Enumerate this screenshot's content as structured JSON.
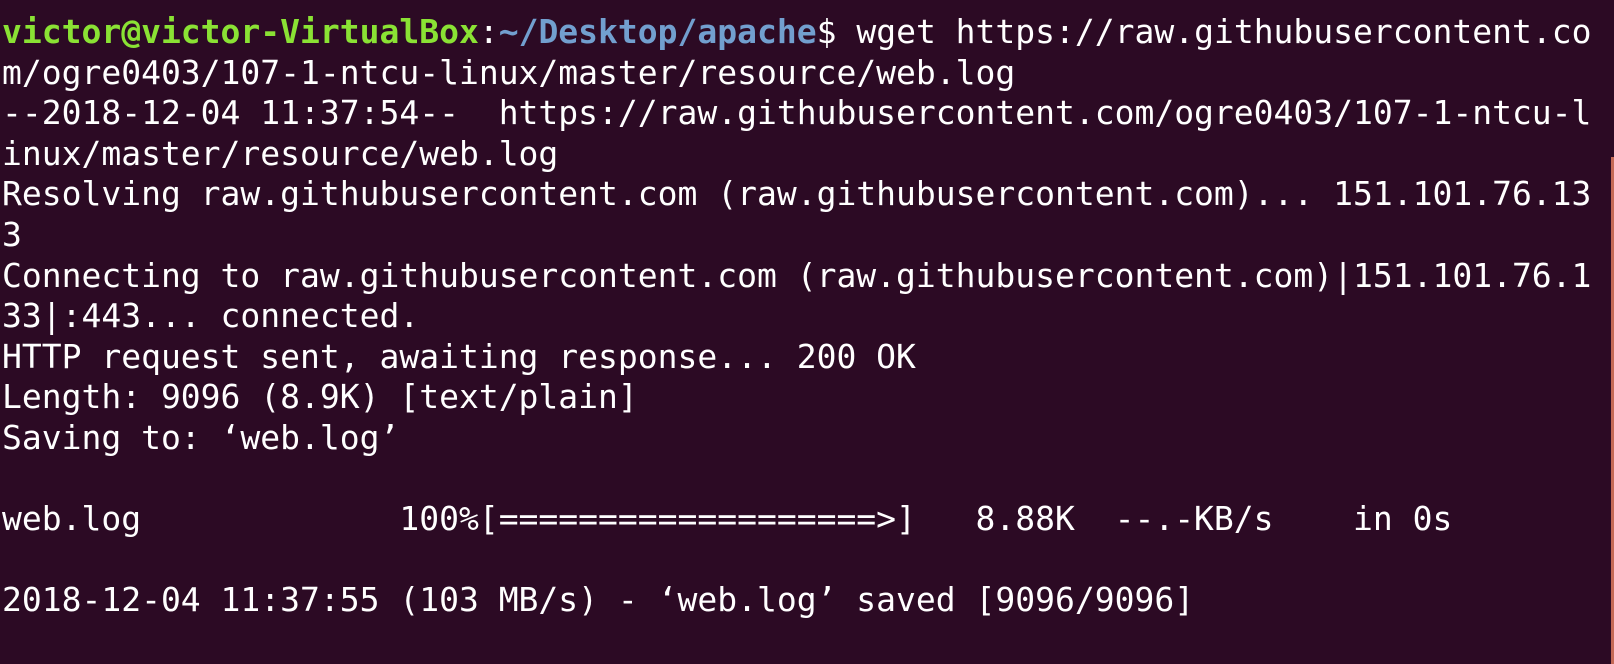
{
  "prompt": {
    "user_host": "victor@victor-VirtualBox",
    "separator": ":",
    "path": "~/Desktop/apache",
    "symbol": "$",
    "command": " wget https://raw.githubusercontent.co"
  },
  "output_lines": [
    "m/ogre0403/107-1-ntcu-linux/master/resource/web.log",
    "--2018-12-04 11:37:54--  https://raw.githubusercontent.com/ogre0403/107-1-ntcu-l",
    "inux/master/resource/web.log",
    "Resolving raw.githubusercontent.com (raw.githubusercontent.com)... 151.101.76.13",
    "3",
    "Connecting to raw.githubusercontent.com (raw.githubusercontent.com)|151.101.76.1",
    "33|:443... connected.",
    "HTTP request sent, awaiting response... 200 OK",
    "Length: 9096 (8.9K) [text/plain]",
    "Saving to: ‘web.log’",
    "",
    "web.log             100%[===================>]   8.88K  --.-KB/s    in 0s",
    "",
    "2018-12-04 11:37:55 (103 MB/s) - ‘web.log’ saved [9096/9096]"
  ],
  "colors": {
    "background": "#2c0a24",
    "prompt_user": "#8ae234",
    "prompt_path": "#729fcf",
    "text": "#ffffff"
  }
}
